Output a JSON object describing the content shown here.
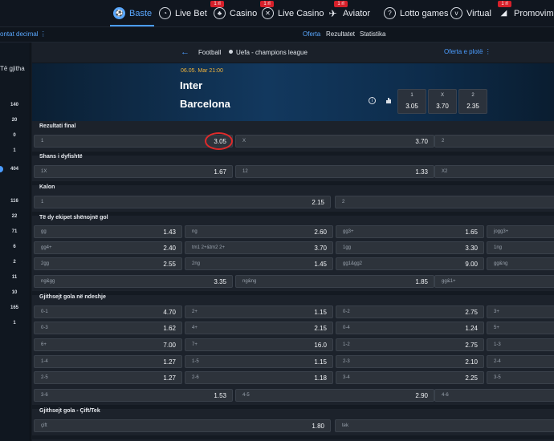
{
  "top_nav": {
    "items": [
      {
        "label": "Baste",
        "icon": "soccer-ball-icon",
        "active": true
      },
      {
        "label": "Live Bet",
        "icon": "live-bet-icon",
        "active": false
      },
      {
        "label": "Casino",
        "icon": "casino-icon",
        "active": false,
        "badge": "1 rl"
      },
      {
        "label": "Live Casino",
        "icon": "live-casino-icon",
        "active": false,
        "badge": "1 rl"
      },
      {
        "label": "Aviator",
        "icon": "aviator-plane-icon",
        "active": false,
        "badge": "1 rl"
      },
      {
        "label": "Lotto games",
        "icon": "lotto-icon",
        "active": false
      },
      {
        "label": "Virtual",
        "icon": "virtual-icon",
        "active": false
      },
      {
        "label": "Promovimet",
        "icon": "promotions-icon",
        "active": false,
        "badge": "1 rl"
      }
    ]
  },
  "sub_nav": {
    "odds_format": "ontat decimal ⋮",
    "tabs": [
      "Oferta",
      "Rezultatet",
      "Statistika"
    ],
    "active_tab": "Oferta"
  },
  "sidebar": {
    "heading": "Të gjitha",
    "counts": [
      "140",
      "20",
      "0",
      "1",
      "404",
      "116",
      "22",
      "71",
      "6",
      "2",
      "11",
      "10",
      "165",
      "1"
    ],
    "selected_count": "404"
  },
  "breadcrumb": {
    "sport": "Football",
    "competition": "Uefa - champions league",
    "full_offer": "Oferta e plotë ⋮"
  },
  "match": {
    "date": "06.05. Mar 21:00",
    "home": "Inter",
    "away": "Barcelona",
    "odds": [
      {
        "label": "1",
        "value": "3.05"
      },
      {
        "label": "X",
        "value": "3.70"
      },
      {
        "label": "2",
        "value": "2.35"
      }
    ]
  },
  "markets": [
    {
      "title": "Rezultati final",
      "rows": [
        [
          {
            "l": "1",
            "v": "3.05"
          },
          {
            "l": "X",
            "v": "3.70"
          },
          {
            "l": "2",
            "v": ""
          }
        ]
      ]
    },
    {
      "title": "Shans i dyfishtë",
      "rows": [
        [
          {
            "l": "1X",
            "v": "1.67"
          },
          {
            "l": "12",
            "v": "1.33"
          },
          {
            "l": "X2",
            "v": ""
          }
        ]
      ]
    },
    {
      "title": "Kalon",
      "rows": [
        [
          {
            "l": "1",
            "v": "2.15"
          },
          {
            "l": "2",
            "v": ""
          }
        ]
      ]
    },
    {
      "title": "Të dy ekipet shënojnë gol",
      "rows": [
        [
          {
            "l": "gg",
            "v": "1.43"
          },
          {
            "l": "ng",
            "v": "2.60"
          },
          {
            "l": "gg3+",
            "v": "1.65"
          },
          {
            "l": "jogg3+",
            "v": ""
          }
        ],
        [
          {
            "l": "gg4+",
            "v": "2.40"
          },
          {
            "l": "tm1 2+&tm2 2+",
            "v": "3.70"
          },
          {
            "l": "1gg",
            "v": "3.30"
          },
          {
            "l": "1ng",
            "v": ""
          }
        ],
        [
          {
            "l": "2gg",
            "v": "2.55"
          },
          {
            "l": "2ng",
            "v": "1.45"
          },
          {
            "l": "gg1&gg2",
            "v": "9.00"
          },
          {
            "l": "gg&ng",
            "v": ""
          }
        ],
        [
          {
            "l": "ng&gg",
            "v": "3.35"
          },
          {
            "l": "ng&ng",
            "v": "1.85"
          },
          {
            "l": "gg&1+",
            "v": ""
          }
        ]
      ]
    },
    {
      "title": "Gjithsejt gola në ndeshje",
      "rows": [
        [
          {
            "l": "0-1",
            "v": "4.70"
          },
          {
            "l": "2+",
            "v": "1.15"
          },
          {
            "l": "0-2",
            "v": "2.75"
          },
          {
            "l": "3+",
            "v": ""
          }
        ],
        [
          {
            "l": "0-3",
            "v": "1.62"
          },
          {
            "l": "4+",
            "v": "2.15"
          },
          {
            "l": "0-4",
            "v": "1.24"
          },
          {
            "l": "5+",
            "v": ""
          }
        ],
        [
          {
            "l": "6+",
            "v": "7.00"
          },
          {
            "l": "7+",
            "v": "16.0"
          },
          {
            "l": "1-2",
            "v": "2.75"
          },
          {
            "l": "1-3",
            "v": ""
          }
        ],
        [
          {
            "l": "1-4",
            "v": "1.27"
          },
          {
            "l": "1-5",
            "v": "1.15"
          },
          {
            "l": "2-3",
            "v": "2.10"
          },
          {
            "l": "2-4",
            "v": ""
          }
        ],
        [
          {
            "l": "2-5",
            "v": "1.27"
          },
          {
            "l": "2-6",
            "v": "1.18"
          },
          {
            "l": "3-4",
            "v": "2.25"
          },
          {
            "l": "3-5",
            "v": ""
          }
        ],
        [
          {
            "l": "3-6",
            "v": "1.53"
          },
          {
            "l": "4-5",
            "v": "2.90"
          },
          {
            "l": "4-6",
            "v": ""
          }
        ]
      ]
    },
    {
      "title": "Gjithsejt gola - Çift/Tek",
      "rows": [
        [
          {
            "l": "çift",
            "v": "1.80"
          },
          {
            "l": "tek",
            "v": ""
          }
        ]
      ]
    }
  ],
  "highlight": {
    "market": "Rezultati final",
    "selection": "1",
    "value": "3.05"
  },
  "colors": {
    "accent": "#4a9cff",
    "highlight_ring": "#e02a2a",
    "badge": "#d6202a",
    "date": "#f3b43a"
  }
}
